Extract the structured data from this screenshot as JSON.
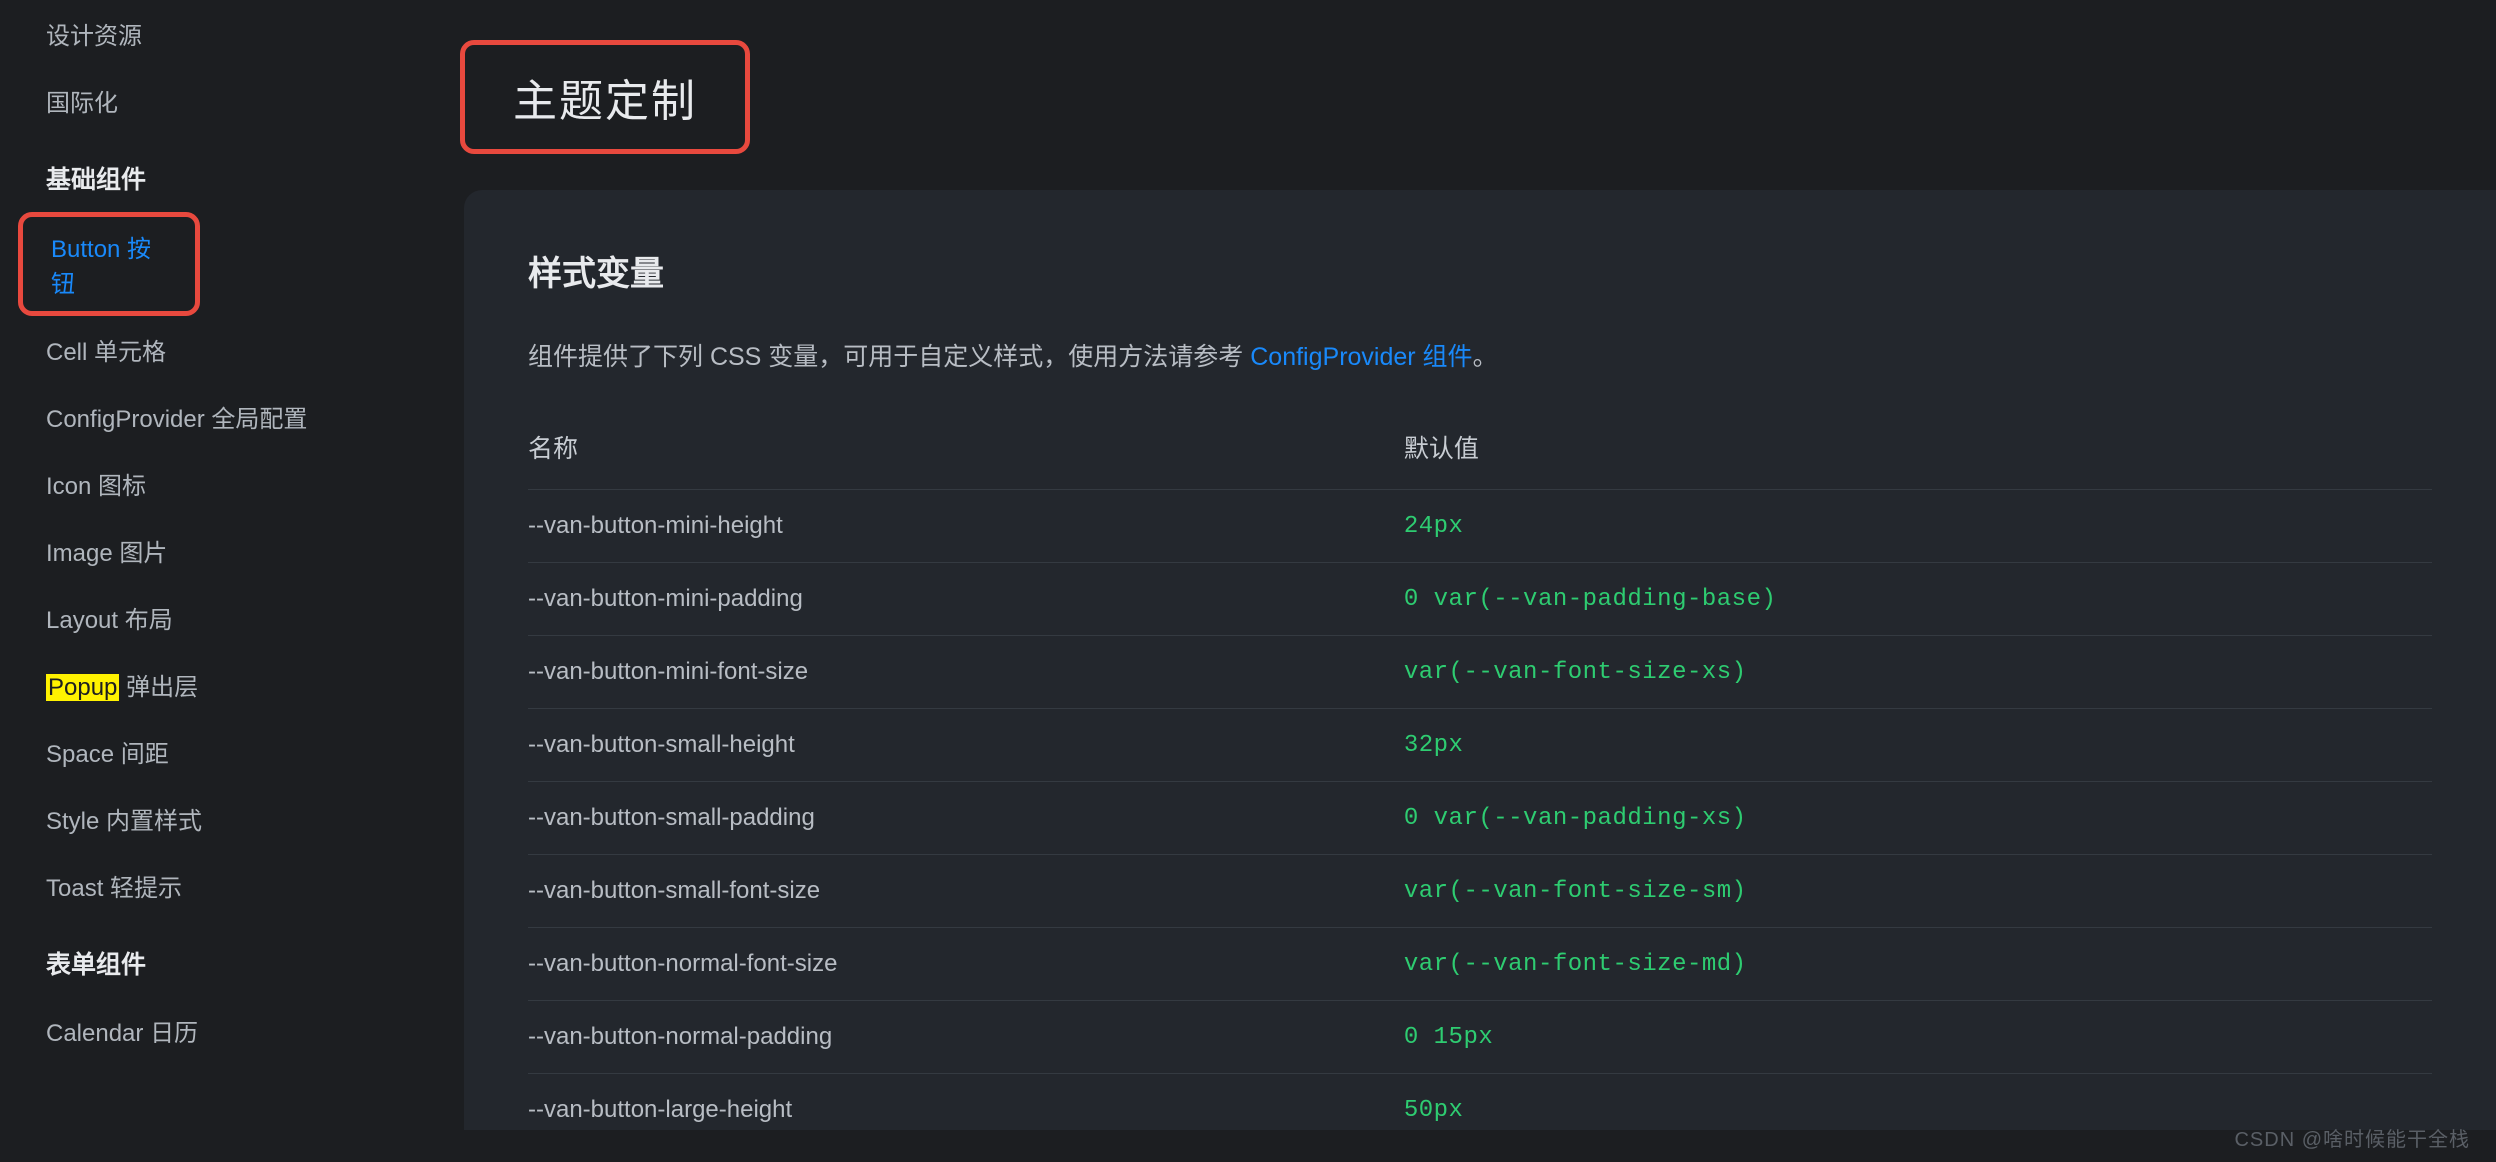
{
  "sidebar": {
    "top_items": [
      {
        "label": "设计资源",
        "name": "sidebar-item-design-resources"
      },
      {
        "label": "国际化",
        "name": "sidebar-item-i18n"
      }
    ],
    "group1_heading": "基础组件",
    "group1_items": [
      {
        "label": "Button 按钮",
        "name": "sidebar-item-button",
        "active": true,
        "boxed": true
      },
      {
        "label": "Cell 单元格",
        "name": "sidebar-item-cell"
      },
      {
        "label": "ConfigProvider 全局配置",
        "name": "sidebar-item-configprovider"
      },
      {
        "label": "Icon 图标",
        "name": "sidebar-item-icon"
      },
      {
        "label": "Image 图片",
        "name": "sidebar-item-image"
      },
      {
        "label": "Layout 布局",
        "name": "sidebar-item-layout"
      },
      {
        "label_pre": "Popup",
        "label_post": " 弹出层",
        "name": "sidebar-item-popup",
        "highlighted": true
      },
      {
        "label": "Space 间距",
        "name": "sidebar-item-space"
      },
      {
        "label": "Style 内置样式",
        "name": "sidebar-item-style"
      },
      {
        "label": "Toast 轻提示",
        "name": "sidebar-item-toast"
      }
    ],
    "group2_heading": "表单组件",
    "group2_items": [
      {
        "label": "Calendar 日历",
        "name": "sidebar-item-calendar"
      }
    ]
  },
  "main": {
    "page_title": "主题定制",
    "section_title": "样式变量",
    "desc_prefix": "组件提供了下列 CSS 变量，可用于自定义样式，使用方法请参考 ",
    "desc_link": "ConfigProvider 组件",
    "desc_suffix": "。",
    "table": {
      "col_name": "名称",
      "col_value": "默认值",
      "rows": [
        {
          "name": "--van-button-mini-height",
          "value": "24px"
        },
        {
          "name": "--van-button-mini-padding",
          "value": "0 var(--van-padding-base)"
        },
        {
          "name": "--van-button-mini-font-size",
          "value": "var(--van-font-size-xs)"
        },
        {
          "name": "--van-button-small-height",
          "value": "32px"
        },
        {
          "name": "--van-button-small-padding",
          "value": "0 var(--van-padding-xs)"
        },
        {
          "name": "--van-button-small-font-size",
          "value": "var(--van-font-size-sm)"
        },
        {
          "name": "--van-button-normal-font-size",
          "value": "var(--van-font-size-md)"
        },
        {
          "name": "--van-button-normal-padding",
          "value": "0 15px"
        },
        {
          "name": "--van-button-large-height",
          "value": "50px"
        }
      ]
    }
  },
  "watermark": "CSDN @啥时候能干全栈"
}
